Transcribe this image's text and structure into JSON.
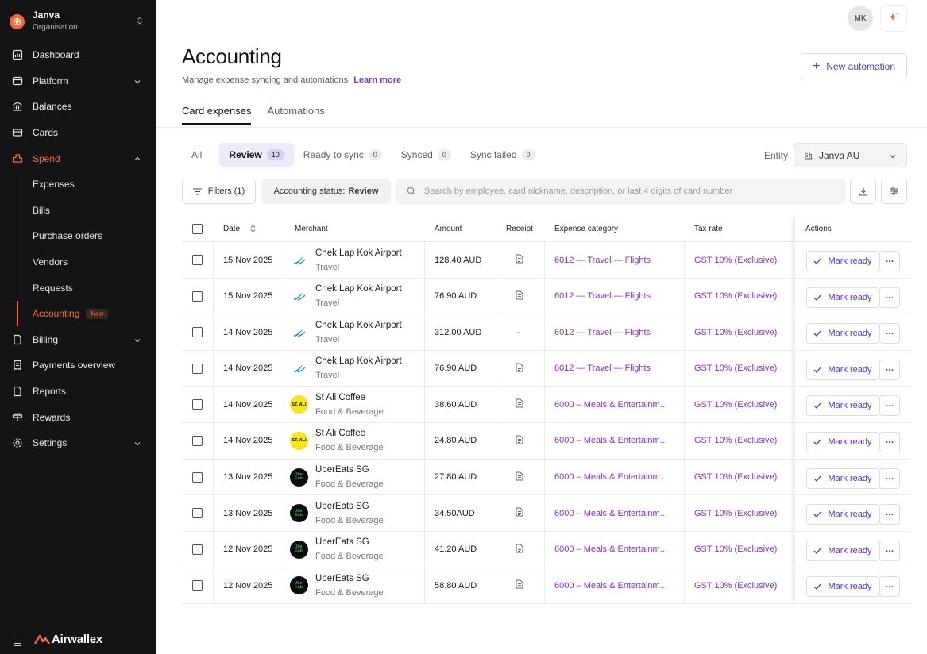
{
  "org": {
    "name": "Janva",
    "subtitle": "Organisation"
  },
  "nav": {
    "dashboard": "Dashboard",
    "platform": "Platform",
    "balances": "Balances",
    "cards": "Cards",
    "spend": "Spend",
    "spend_items": [
      "Expenses",
      "Bills",
      "Purchase orders",
      "Vendors",
      "Requests",
      "Accounting"
    ],
    "accounting_badge": "New",
    "billing": "Billing",
    "payments_overview": "Payments overview",
    "reports": "Reports",
    "rewards": "Rewards",
    "settings": "Settings"
  },
  "brand": {
    "logo_text": "Airwallex",
    "accent": "#f26b3a"
  },
  "header": {
    "avatar_initials": "MK"
  },
  "page": {
    "title": "Accounting",
    "subtitle": "Manage expense syncing and automations",
    "learn_more": "Learn more",
    "new_automation": "New automation"
  },
  "tabs": [
    "Card expenses",
    "Automations"
  ],
  "status_tabs": [
    {
      "label": "All",
      "count": null
    },
    {
      "label": "Review",
      "count": "10"
    },
    {
      "label": "Ready to sync",
      "count": "0"
    },
    {
      "label": "Synced",
      "count": "0"
    },
    {
      "label": "Sync failed",
      "count": "0"
    }
  ],
  "entity": {
    "label": "Entity",
    "value": "Janva AU"
  },
  "filters": {
    "button": "Filters (1)",
    "chip_label": "Accounting status:",
    "chip_value": "Review",
    "search_placeholder": "Search by employee, card nickname, description, or last 4 digits of card number"
  },
  "table": {
    "columns": [
      "Date",
      "Merchant",
      "Amount",
      "Receipt",
      "Expense category",
      "Tax rate",
      "Actions"
    ],
    "action_label": "Mark ready",
    "more_label": "···",
    "rows": [
      {
        "date": "15 Nov 2025",
        "merchant": "Chek Lap Kok Airport",
        "category_sub": "Travel",
        "logo": "cathay",
        "amount": "128.40 AUD",
        "receipt": "doc",
        "expense_category": "6012 — Travel — Flights",
        "tax": "GST 10% (Exclusive)"
      },
      {
        "date": "15 Nov 2025",
        "merchant": "Chek Lap Kok Airport",
        "category_sub": "Travel",
        "logo": "cathay",
        "amount": "76.90 AUD",
        "receipt": "doc",
        "expense_category": "6012 — Travel — Flights",
        "tax": "GST 10% (Exclusive)"
      },
      {
        "date": "14 Nov 2025",
        "merchant": "Chek Lap Kok Airport",
        "category_sub": "Travel",
        "logo": "cathay",
        "amount": "312.00 AUD",
        "receipt": "–",
        "expense_category": "6012 — Travel — Flights",
        "tax": "GST 10% (Exclusive)"
      },
      {
        "date": "14 Nov 2025",
        "merchant": "Chek Lap Kok Airport",
        "category_sub": "Travel",
        "logo": "cathay",
        "amount": "76.90 AUD",
        "receipt": "doc",
        "expense_category": "6012 — Travel — Flights",
        "tax": "GST 10% (Exclusive)"
      },
      {
        "date": "14 Nov 2025",
        "merchant": "St Ali Coffee",
        "category_sub": "Food & Beverage",
        "logo": "stali",
        "amount": "38.60 AUD",
        "receipt": "doc",
        "expense_category": "6000 – Meals & Entertainm...",
        "tax": "GST 10% (Exclusive)"
      },
      {
        "date": "14 Nov 2025",
        "merchant": "St Ali Coffee",
        "category_sub": "Food & Beverage",
        "logo": "stali",
        "amount": "24.80 AUD",
        "receipt": "doc",
        "expense_category": "6000 – Meals & Entertainm...",
        "tax": "GST 10% (Exclusive)"
      },
      {
        "date": "13 Nov 2025",
        "merchant": "UberEats SG",
        "category_sub": "Food & Beverage",
        "logo": "uber",
        "amount": "27.80 AUD",
        "receipt": "doc",
        "expense_category": "6000 – Meals & Entertainm...",
        "tax": "GST 10% (Exclusive)"
      },
      {
        "date": "13 Nov 2025",
        "merchant": "UberEats SG",
        "category_sub": "Food & Beverage",
        "logo": "uber",
        "amount": "34.50AUD",
        "receipt": "doc",
        "expense_category": "6000 – Meals & Entertainm...",
        "tax": "GST 10% (Exclusive)"
      },
      {
        "date": "12 Nov 2025",
        "merchant": "UberEats SG",
        "category_sub": "Food & Beverage",
        "logo": "uber",
        "amount": "41.20 AUD",
        "receipt": "doc",
        "expense_category": "6000 – Meals & Entertainm...",
        "tax": "GST 10% (Exclusive)"
      },
      {
        "date": "12 Nov 2025",
        "merchant": "UberEats SG",
        "category_sub": "Food & Beverage",
        "logo": "uber",
        "amount": "58.80 AUD",
        "receipt": "doc",
        "expense_category": "6000 – Meals & Entertainm...",
        "tax": "GST 10% (Exclusive)"
      }
    ]
  },
  "logo_text": {
    "stali": "ST. ALI",
    "uber_line1": "Uber",
    "uber_line2": "Eats"
  }
}
